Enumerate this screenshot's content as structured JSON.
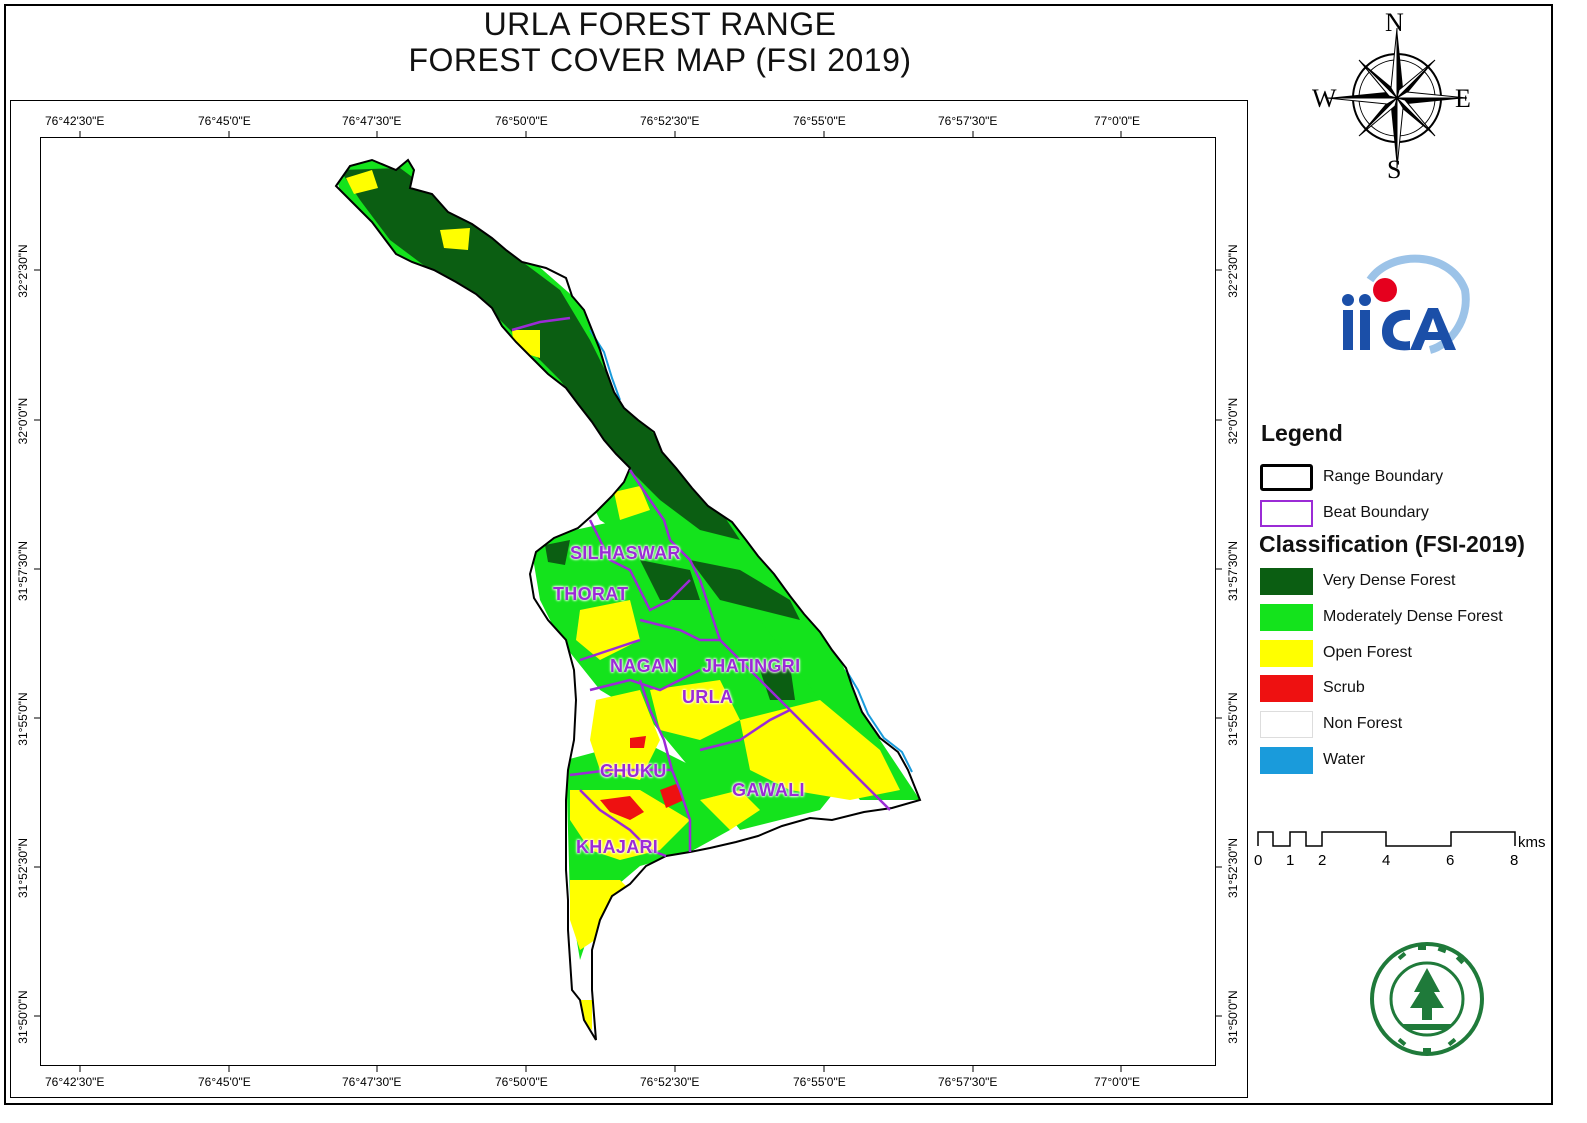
{
  "title": {
    "line1": "URLA FOREST RANGE",
    "line2": "FOREST COVER MAP (FSI 2019)"
  },
  "graticule": {
    "longitudes": [
      "76°42'30\"E",
      "76°45'0\"E",
      "76°47'30\"E",
      "76°50'0\"E",
      "76°52'30\"E",
      "76°55'0\"E",
      "76°57'30\"E",
      "77°0'0\"E"
    ],
    "latitudes": [
      "32°2'30\"N",
      "32°0'0\"N",
      "31°57'30\"N",
      "31°55'0\"N",
      "31°52'30\"N",
      "31°50'0\"N"
    ]
  },
  "compass": {
    "n": "N",
    "e": "E",
    "s": "S",
    "w": "W"
  },
  "legend": {
    "title": "Legend",
    "boundaries": [
      {
        "label": "Range Boundary",
        "color": "#000000"
      },
      {
        "label": "Beat Boundary",
        "color": "#9b2bd6"
      }
    ],
    "classification_title": "Classification (FSI-2019)",
    "classes": [
      {
        "label": "Very Dense Forest",
        "color": "#0b5e12"
      },
      {
        "label": "Moderately Dense Forest",
        "color": "#14e31c"
      },
      {
        "label": "Open Forest",
        "color": "#ffff00"
      },
      {
        "label": "Scrub",
        "color": "#ee1111"
      },
      {
        "label": "Non Forest",
        "color": "#ffffff"
      },
      {
        "label": "Water",
        "color": "#1a9bdb"
      }
    ]
  },
  "scalebar": {
    "labels": [
      "0",
      "1",
      "2",
      "4",
      "6",
      "8"
    ],
    "unit": "kms"
  },
  "beats": [
    "SILHASWAR",
    "THORAT",
    "NAGAN",
    "JHATINGRI",
    "URLA",
    "CHUKU",
    "GAWALI",
    "KHAJARI"
  ]
}
